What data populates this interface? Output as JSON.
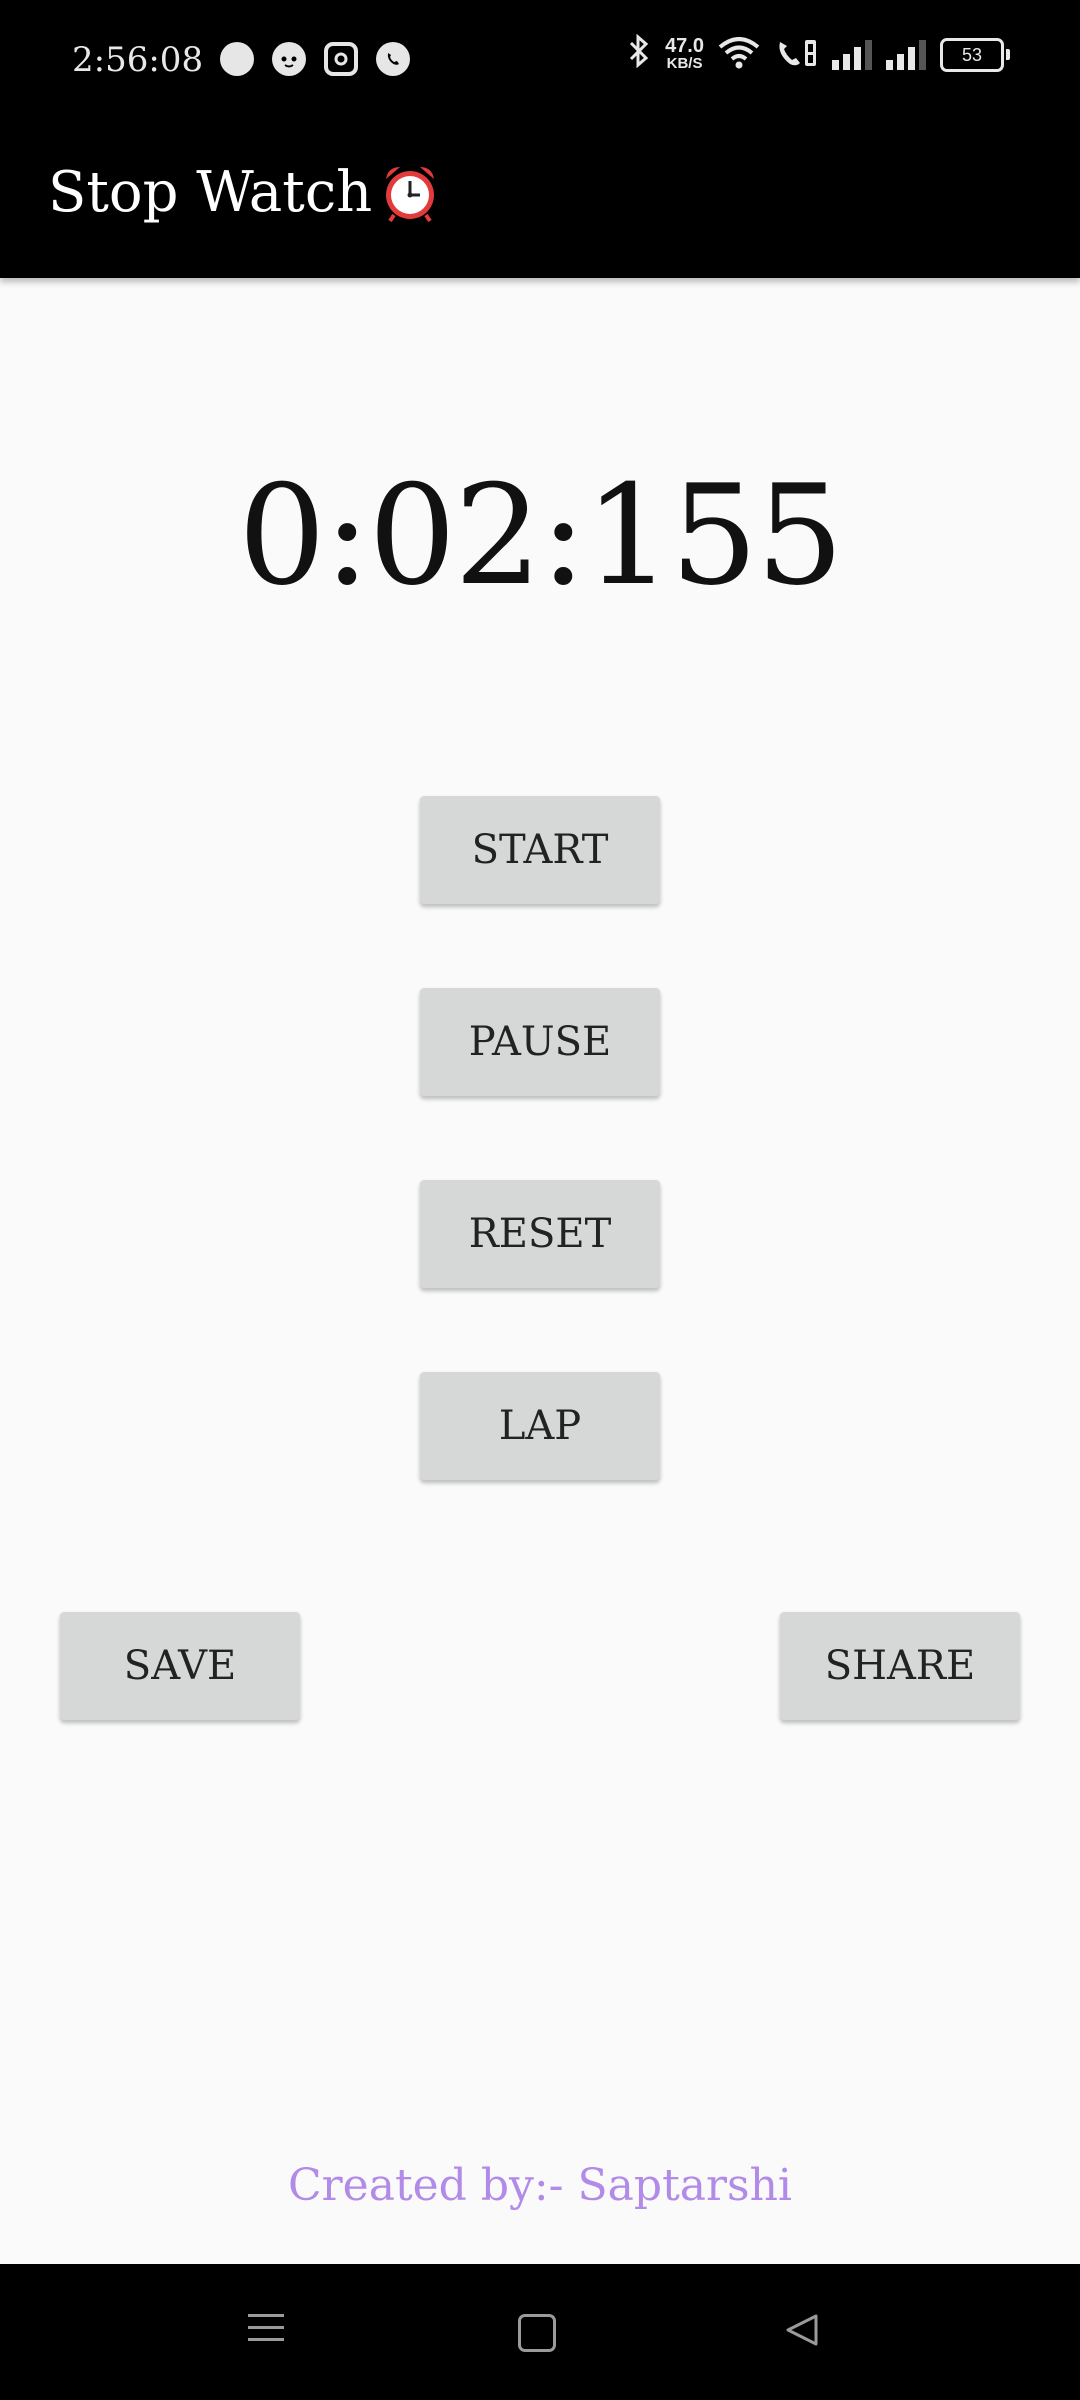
{
  "status_bar": {
    "time": "2:56:08",
    "net_speed_value": "47.0",
    "net_speed_unit": "KB/S",
    "battery_level": "53",
    "notification_icons": [
      "chat-bubble-icon",
      "cat-face-icon",
      "instagram-icon",
      "whatsapp-icon"
    ],
    "system_icons": [
      "bluetooth-icon",
      "wifi-icon",
      "volte-call-icon",
      "signal-icon",
      "signal-icon",
      "battery-icon"
    ]
  },
  "app_bar": {
    "title": "Stop Watch",
    "title_icon": "alarm-clock-icon"
  },
  "timer": {
    "display": "0:02:155"
  },
  "buttons": {
    "start": "START",
    "pause": "PAUSE",
    "reset": "RESET",
    "lap": "LAP",
    "save": "SAVE",
    "share": "SHARE"
  },
  "footer": {
    "credit": "Created by:- Saptarshi"
  },
  "nav_bar": {
    "icons": [
      "menu-icon",
      "home-icon",
      "back-icon"
    ]
  },
  "colors": {
    "bar_background": "#000000",
    "page_background": "#fafafa",
    "button_background": "#d6d7d7",
    "credit_text": "#b28ae8"
  }
}
